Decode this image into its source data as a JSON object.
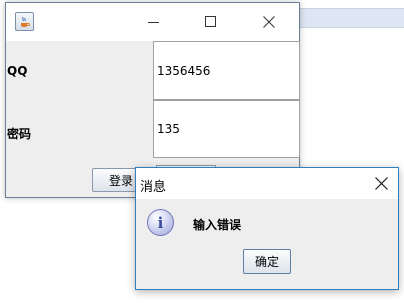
{
  "login_window": {
    "labels": {
      "qq": "QQ",
      "password": "密码"
    },
    "fields": {
      "qq_value": "1356456",
      "password_value": "135"
    },
    "login_button": "登录"
  },
  "message_dialog": {
    "title": "消息",
    "message": "输入错误",
    "ok_button": "确定",
    "icon": "info-icon"
  },
  "colors": {
    "dialog_border": "#2e7fbf",
    "window_bg": "#eeeeee",
    "desktop_strip": "#dde6f2"
  }
}
